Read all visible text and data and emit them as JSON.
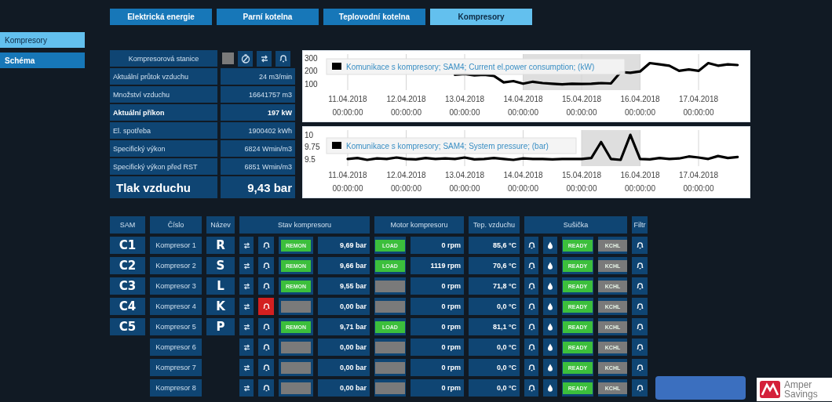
{
  "tabs": [
    {
      "label": "Elektrická energie",
      "selected": false
    },
    {
      "label": "Parní kotelna",
      "selected": false
    },
    {
      "label": "Teplovodní kotelna",
      "selected": false
    },
    {
      "label": "Kompresory",
      "selected": true
    }
  ],
  "sidebar": {
    "items": [
      {
        "label": "Kompresory",
        "selected": true
      },
      {
        "label": "Schéma",
        "selected": false
      }
    ]
  },
  "station": {
    "title": "Kompresorová stanice",
    "running": false,
    "rows": [
      {
        "label": "Aktuální průtok vzduchu",
        "value": "24 m3/min",
        "kind": "normal"
      },
      {
        "label": "Množství vzduchu",
        "value": "16641757 m3",
        "kind": "normal"
      },
      {
        "label": "Aktuální příkon",
        "value": "197 kW",
        "kind": "bold"
      },
      {
        "label": "El. spotřeba",
        "value": "1900402 kWh",
        "kind": "normal"
      },
      {
        "label": "Specifický výkon",
        "value": "6824 Wmin/m3",
        "kind": "normal"
      },
      {
        "label": "Specifický výkon před RST",
        "value": "6851 Wmin/m3",
        "kind": "normal"
      },
      {
        "label": "Tlak vzduchu",
        "value": "9,43 bar",
        "kind": "large"
      }
    ]
  },
  "charts": [
    {
      "chart_data": {
        "type": "line",
        "categories": [
          "11.04.2018 00:00:00",
          null,
          null,
          null,
          null,
          null,
          "12.04.2018 00:00:00",
          null,
          null,
          null,
          null,
          null,
          "13.04.2018 00:00:00",
          null,
          null,
          null,
          null,
          null,
          "14.04.2018 00:00:00",
          null,
          null,
          null,
          null,
          null,
          "15.04.2018 00:00:00",
          null,
          null,
          null,
          null,
          null,
          "16.04.2018 00:00:00",
          null,
          null,
          null,
          null,
          null,
          "17.04.2018 00:00:00",
          null,
          null,
          null,
          null
        ],
        "series": [
          {
            "name": "Komunikace s kompresory; SAM4; Current el.power consumption; (kW)",
            "color": "#000000",
            "values": [
              null,
              null,
              null,
              null,
              null,
              null,
              null,
              null,
              null,
              null,
              null,
              170,
              175,
              165,
              170,
              160,
              110,
              120,
              100,
              115,
              105,
              100,
              95,
              100,
              98,
              100,
              105,
              102,
              190,
              185,
              195,
              260,
              250,
              240,
              200,
              210,
              200,
              260,
              240,
              250,
              245
            ]
          }
        ],
        "ylim": [
          50,
          330
        ],
        "yticks": [
          300,
          200,
          100
        ],
        "grid": true
      }
    },
    {
      "chart_data": {
        "type": "line",
        "categories": [
          "11.04.2018 00:00:00",
          null,
          null,
          null,
          null,
          null,
          "12.04.2018 00:00:00",
          null,
          null,
          null,
          null,
          null,
          "13.04.2018 00:00:00",
          null,
          null,
          null,
          null,
          null,
          "14.04.2018 00:00:00",
          null,
          null,
          null,
          null,
          null,
          "15.04.2018 00:00:00",
          null,
          null,
          null,
          null,
          null,
          "16.04.2018 00:00:00",
          null,
          null,
          null,
          null,
          null,
          "17.04.2018 00:00:00",
          null,
          null,
          null,
          null
        ],
        "series": [
          {
            "name": "Komunikace s kompresory; SAM4; System pressure; (bar)",
            "color": "#000000",
            "values": [
              9.5,
              9.52,
              9.48,
              9.51,
              9.5,
              9.53,
              9.5,
              9.49,
              9.52,
              9.5,
              9.51,
              9.5,
              9.53,
              9.49,
              9.5,
              9.52,
              9.5,
              9.48,
              9.51,
              9.5,
              9.5,
              9.49,
              9.5,
              9.5,
              9.5,
              9.52,
              9.85,
              9.5,
              9.48,
              10.0,
              9.5,
              9.49,
              9.52,
              9.5,
              9.51,
              9.55,
              9.53,
              9.5,
              9.56,
              9.52,
              9.54
            ]
          }
        ],
        "ylim": [
          9.35,
          10.1
        ],
        "yticks": [
          10,
          9.75,
          9.5
        ],
        "grid": true
      }
    }
  ],
  "table": {
    "columns": [
      "SAM",
      "Číslo",
      "Název",
      "Stav kompresoru",
      "Motor kompresoru",
      "Tep. vzduchu",
      "Sušička",
      "Filtr"
    ],
    "rows": [
      {
        "sam": "C1",
        "number": "Kompresor 1",
        "name": "R",
        "alarm": false,
        "state": "REMON",
        "pressure": "9,69 bar",
        "motor": "LOAD",
        "rpm": "0 rpm",
        "temp": "85,6 °C",
        "dryer": "READY",
        "dryer_type": "KCHL"
      },
      {
        "sam": "C2",
        "number": "Kompresor 2",
        "name": "S",
        "alarm": false,
        "state": "REMON",
        "pressure": "9,66 bar",
        "motor": "LOAD",
        "rpm": "1119 rpm",
        "temp": "70,6 °C",
        "dryer": "READY",
        "dryer_type": "KCHL"
      },
      {
        "sam": "C3",
        "number": "Kompresor 3",
        "name": "L",
        "alarm": false,
        "state": "REMON",
        "pressure": "9,55 bar",
        "rpm": "0 rpm",
        "temp": "71,8 °C",
        "dryer": "READY",
        "dryer_type": "KCHL"
      },
      {
        "sam": "C4",
        "number": "Kompresor 4",
        "name": "K",
        "alarm": true,
        "pressure": "0,00 bar",
        "rpm": "0 rpm",
        "temp": "0,0 °C",
        "dryer": "READY",
        "dryer_type": "KCHL"
      },
      {
        "sam": "C5",
        "number": "Kompresor 5",
        "name": "P",
        "alarm": false,
        "state": "REMON",
        "pressure": "9,71 bar",
        "motor": "LOAD",
        "rpm": "0 rpm",
        "temp": "81,1 °C",
        "dryer": "READY",
        "dryer_type": "KCHL"
      },
      {
        "number": "Kompresor 6",
        "alarm": false,
        "pressure": "0,00 bar",
        "rpm": "0 rpm",
        "temp": "0,0 °C",
        "dryer": "READY",
        "dryer_type": "KCHL"
      },
      {
        "number": "Kompresor 7",
        "alarm": false,
        "pressure": "0,00 bar",
        "rpm": "0 rpm",
        "temp": "0,0 °C",
        "dryer": "READY",
        "dryer_type": "KCHL"
      },
      {
        "number": "Kompresor 8",
        "alarm": false,
        "pressure": "0,00 bar",
        "rpm": "0 rpm",
        "temp": "0,0 °C",
        "dryer": "READY",
        "dryer_type": "KCHL"
      }
    ]
  },
  "logo": {
    "line1": "Amper",
    "line2": "Savings"
  }
}
